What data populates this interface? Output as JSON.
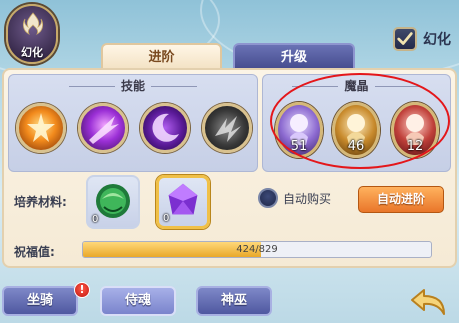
{
  "emblem": {
    "label": "幻化"
  },
  "toggle": {
    "label": "幻化",
    "checked": true
  },
  "tabs": [
    {
      "label": "进阶",
      "active": true
    },
    {
      "label": "升级",
      "active": false
    }
  ],
  "skills": {
    "title": "技能",
    "items": [
      {
        "icon": "star-burst-skill-icon"
      },
      {
        "icon": "purple-slash-skill-icon"
      },
      {
        "icon": "purple-crescent-skill-icon"
      },
      {
        "icon": "shadow-claw-skill-icon"
      }
    ]
  },
  "crystals": {
    "title": "魔晶",
    "items": [
      {
        "icon": "purple-spirit-crystal-icon",
        "count": "51"
      },
      {
        "icon": "golden-spirit-crystal-icon",
        "count": "46"
      },
      {
        "icon": "red-spirit-crystal-icon",
        "count": "12"
      }
    ]
  },
  "materials": {
    "label": "培养材料:",
    "items": [
      {
        "icon": "green-orb-icon",
        "count": "0",
        "selected": false
      },
      {
        "icon": "purple-gem-icon",
        "count": "0",
        "selected": true
      }
    ]
  },
  "auto_buy": {
    "label": "自动购买",
    "checked": false
  },
  "auto_advance": {
    "label": "自动进阶"
  },
  "blessing": {
    "label": "祝福值:",
    "text": "424/829",
    "current": 424,
    "max": 829
  },
  "nav": [
    {
      "label": "坐骑",
      "badge": "!",
      "active": false
    },
    {
      "label": "侍魂",
      "active": true
    },
    {
      "label": "神巫",
      "active": false
    }
  ],
  "colors": {
    "accent": "#e9762a",
    "highlight_ring": "#e4161a",
    "tab_active": "#f3e2c4",
    "tab_inactive": "#454c8e"
  }
}
